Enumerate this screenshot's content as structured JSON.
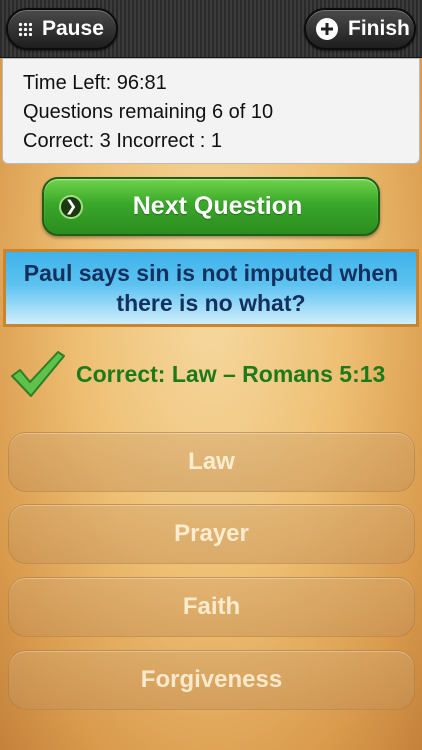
{
  "toolbar": {
    "pause_label": "Pause",
    "finish_label": "Finish"
  },
  "stats": {
    "time_left": "Time Left: 96:81",
    "questions_remaining": "Questions remaining 6 of 10",
    "score": "Correct: 3 Incorrect : 1"
  },
  "next_button": {
    "label": "Next Question"
  },
  "question": {
    "line1": "Paul says sin is not imputed when",
    "line2": "there is no what?"
  },
  "feedback": {
    "text": "Correct: Law – Romans 5:13",
    "icon": "checkmark-icon",
    "color": "#1d7a18"
  },
  "answers": [
    {
      "label": "Law"
    },
    {
      "label": "Prayer"
    },
    {
      "label": "Faith"
    },
    {
      "label": "Forgiveness"
    }
  ],
  "colors": {
    "next_button": "#3aa72a",
    "question_bg": "#5cc2f0",
    "question_text": "#14305e",
    "question_border": "#c9852d"
  }
}
